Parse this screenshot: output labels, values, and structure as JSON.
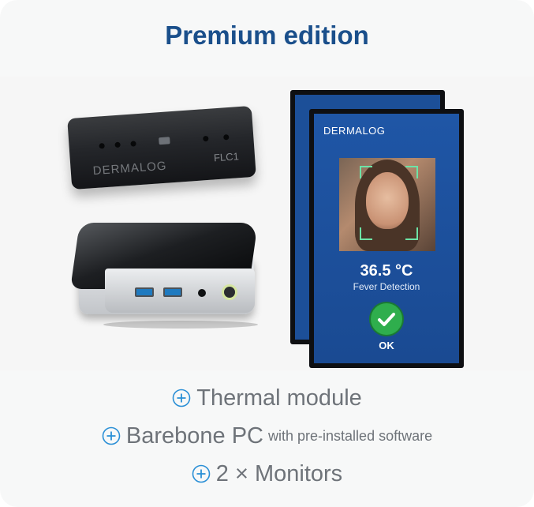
{
  "title": "Premium edition",
  "product_image": {
    "module_brand": "DERMALOG",
    "module_code": "FLC1",
    "monitor_brand": "DERMALOG",
    "temperature": "36.5 °C",
    "status_label": "Fever Detection",
    "status_ok": "OK"
  },
  "features": [
    {
      "label": "Thermal module",
      "note": ""
    },
    {
      "label": "Barebone PC",
      "note": "with pre-installed software"
    },
    {
      "label": "2 × Monitors",
      "note": ""
    }
  ],
  "icons": {
    "bullet": "plus-circle-icon",
    "confirm": "check-circle-icon"
  },
  "colors": {
    "title": "#1a4f8b",
    "bullet_icon": "#2a8fd6",
    "feature_text": "#6e7379",
    "card_background": "#f7f8f8",
    "screen_blue": "#1f56a6",
    "ok_green": "#2fae4d"
  }
}
